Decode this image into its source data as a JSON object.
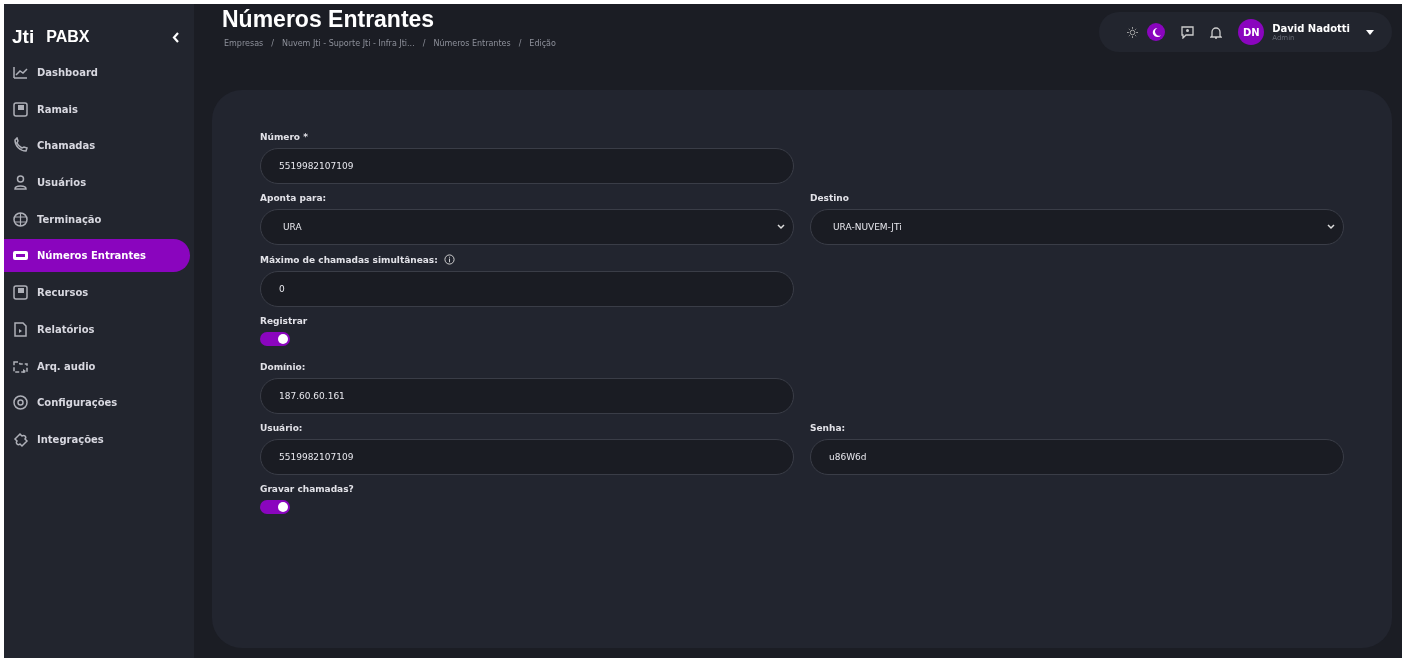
{
  "sidebar": {
    "logo": "Jti",
    "product": "PABX",
    "items": [
      {
        "label": "Dashboard",
        "kind": "chart",
        "selected": false
      },
      {
        "label": "Ramais",
        "kind": "panel",
        "selected": false
      },
      {
        "label": "Chamadas",
        "kind": "phone",
        "selected": false
      },
      {
        "label": "Usuários",
        "kind": "user",
        "selected": false
      },
      {
        "label": "Terminação",
        "kind": "globe",
        "selected": false
      },
      {
        "label": "Números Entrantes",
        "kind": "badge",
        "selected": true
      },
      {
        "label": "Recursos",
        "kind": "panel",
        "selected": false
      },
      {
        "label": "Relatórios",
        "kind": "file",
        "selected": false
      },
      {
        "label": "Arq. audio",
        "kind": "folder",
        "selected": false
      },
      {
        "label": "Configurações",
        "kind": "gear",
        "selected": false
      },
      {
        "label": "Integrações",
        "kind": "puzzle",
        "selected": false
      }
    ]
  },
  "header": {
    "title": "Números Entrantes",
    "breadcrumb_separator": "/",
    "breadcrumbs": [
      "Empresas",
      "Nuvem Jti - Suporte Jti - Infra Jti...",
      "Números Entrantes",
      "Edição"
    ],
    "theme_options": [
      {
        "kind": "sun",
        "selected": false
      },
      {
        "kind": "moon",
        "selected": true
      }
    ],
    "user": {
      "initials": "DN",
      "name": "David Nadotti",
      "role": "Admin"
    }
  },
  "form": {
    "rows": [
      [
        {
          "kind": "input",
          "label": "Número *",
          "value": "5519982107109"
        }
      ],
      [
        {
          "kind": "select",
          "label": "Aponta para:",
          "value": "URA"
        },
        {
          "kind": "select",
          "label": "Destino",
          "value": "URA-NUVEM-JTi"
        }
      ],
      [
        {
          "kind": "input",
          "label": "Máximo de chamadas simultâneas:",
          "value": "0",
          "hint_icon": true
        }
      ],
      [
        {
          "kind": "toggle",
          "label": "Registrar",
          "on": true
        }
      ],
      [
        {
          "kind": "input",
          "label": "Domínio:",
          "value": "187.60.60.161"
        }
      ],
      [
        {
          "kind": "input",
          "label": "Usuário:",
          "value": "5519982107109"
        },
        {
          "kind": "input",
          "label": "Senha:",
          "value": "u86W6d"
        }
      ],
      [
        {
          "kind": "toggle",
          "label": "Gravar chamadas?",
          "on": true
        }
      ]
    ]
  }
}
